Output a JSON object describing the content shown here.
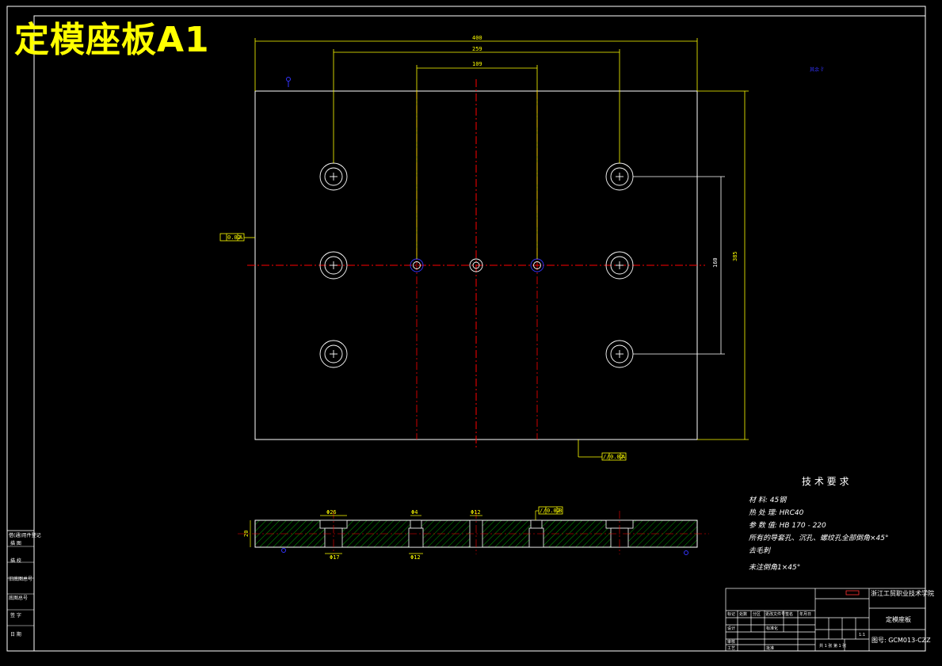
{
  "sheet_title": "定模座板A1",
  "dimensions": {
    "width_total": "400",
    "hole_span_outer": "259",
    "hole_span_inner": "109",
    "height_total": "385",
    "hole_pitch_vertical": "160"
  },
  "tolerances": {
    "left_flatness": "0.02",
    "left_datum": "A",
    "bottom_parallel": "0.02",
    "bottom_datum": "A",
    "section_parallel": "0.02",
    "section_datum": "B"
  },
  "section_labels": {
    "hole1": "Φ26",
    "hole1_bottom": "Φ17",
    "hole2": "Φ4",
    "hole2_bottom": "Φ12",
    "hole3": "Φ12",
    "thickness": "20"
  },
  "tech_requirements": {
    "heading": "技 术 要 求",
    "lines": [
      "材    料: 45钢",
      "热 处 理: HRC40",
      "参 数 值: HB 170 - 220",
      "所有的导套孔、沉孔、螺纹孔全部倒角×45°",
      "去毛刺",
      "未注倒角1×45°"
    ]
  },
  "title_block": {
    "school": "浙江工贸职业技术学院",
    "part_name": "定模座板",
    "drawing_no": "图号: GCM013-CZZ",
    "scale": "1:1",
    "sheet": "共 1 张  第 1 张",
    "row_labels": [
      "标记",
      "处数",
      "分区",
      "更改文件号",
      "签名",
      "年月日"
    ],
    "bottom_labels": [
      "设计",
      "标准化",
      "审核",
      "工艺",
      "批准"
    ]
  },
  "side_strip": {
    "labels": [
      "借(通)用件登记",
      "描 图",
      "描 校",
      "旧底图总号",
      "底图总号",
      "签 字",
      "日 期"
    ]
  }
}
